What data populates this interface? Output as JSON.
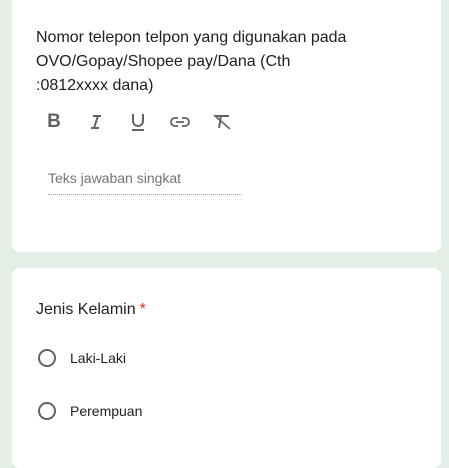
{
  "question1": {
    "title": "Nomor telepon  telpon yang digunakan pada OVO/Gopay/Shopee pay/Dana (Cth :0812xxxx dana)",
    "toolbar": {
      "bold": "B",
      "icons": [
        "bold-icon",
        "italic-icon",
        "underline-icon",
        "link-icon",
        "clear-format-icon"
      ]
    },
    "answer_placeholder": "Teks jawaban singkat"
  },
  "question2": {
    "title": "Jenis Kelamin",
    "required_mark": "*",
    "options": [
      {
        "label": "Laki-Laki",
        "selected": false
      },
      {
        "label": "Perempuan",
        "selected": false
      }
    ]
  },
  "colors": {
    "background": "#e4eee6",
    "card": "#ffffff",
    "required": "#d93025",
    "icon": "#5f6368"
  }
}
